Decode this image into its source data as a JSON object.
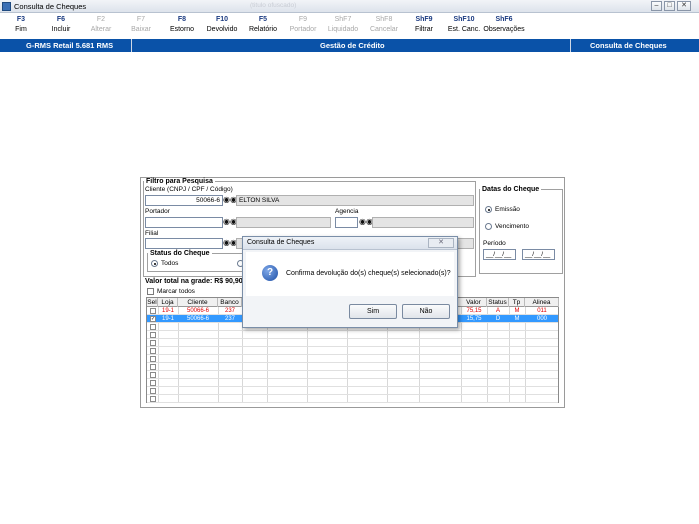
{
  "window": {
    "title": "Consulta de Cheques",
    "blurred_text": "(titulo ofuscado)"
  },
  "window_buttons": {
    "minimize": "–",
    "restore": "□",
    "close": "✕"
  },
  "toolbar": [
    {
      "key": "F3",
      "label": "Fim",
      "enabled": true
    },
    {
      "key": "F6",
      "label": "Incluir",
      "enabled": true
    },
    {
      "key": "F2",
      "label": "Alterar",
      "enabled": false
    },
    {
      "key": "F7",
      "label": "Baixar",
      "enabled": false
    },
    {
      "key": "F8",
      "label": "Estorno",
      "enabled": true
    },
    {
      "key": "F10",
      "label": "Devolvido",
      "enabled": true
    },
    {
      "key": "F5",
      "label": "Relatório",
      "enabled": true
    },
    {
      "key": "F9",
      "label": "Portador",
      "enabled": false
    },
    {
      "key": "ShF7",
      "label": "Liquidado",
      "enabled": false
    },
    {
      "key": "ShF8",
      "label": "Cancelar",
      "enabled": false
    },
    {
      "key": "ShF9",
      "label": "Filtrar",
      "enabled": true
    },
    {
      "key": "ShF10",
      "label": "Est. Canc.",
      "enabled": true
    },
    {
      "key": "ShF6",
      "label": "Observações",
      "enabled": true
    }
  ],
  "header": {
    "app": "G-RMS Retail 5.681 RMS",
    "module": "Gestão de Crédito",
    "screen": "Consulta de Cheques"
  },
  "filter": {
    "legend": "Filtro para Pesquisa",
    "client_label": "Cliente (CNPJ / CPF / Código)",
    "client_code": "50066-6",
    "client_name": "ELTON SILVA",
    "portador_label": "Portador",
    "agencia_label": "Agencia",
    "filial_label": "Filial"
  },
  "datas": {
    "legend": "Datas do Cheque",
    "opt1": "Emissão",
    "opt2": "Vencimento",
    "periodo_label": "Período",
    "date_from": "__/__/__",
    "date_to": "__/__/__"
  },
  "status": {
    "legend": "Status do Cheque",
    "opt_todos": "Todos"
  },
  "grid": {
    "total_label": "Valor total na grade: R$ 90,90",
    "marcar_todos": "Marcar todos",
    "columns": [
      "Sel",
      "Loja",
      "Cliente",
      "Banco",
      "A",
      "Valor",
      "Status",
      "Tp",
      "Alinea"
    ],
    "rows": [
      {
        "checked": false,
        "loja": "19-1",
        "cliente": "50066-6",
        "banco": "237",
        "valor": "75,15",
        "status": "A",
        "tp": "M",
        "alinea": "011"
      },
      {
        "checked": true,
        "loja": "19-1",
        "cliente": "50066-6",
        "banco": "237",
        "valor": "15,75",
        "status": "D",
        "tp": "M",
        "alinea": "000"
      }
    ]
  },
  "dialog": {
    "title": "Consulta de Cheques",
    "message": "Confirma devolução do(s) cheque(s) selecionado(s)?",
    "yes": "Sim",
    "no": "Não",
    "close_glyph": "✕"
  }
}
